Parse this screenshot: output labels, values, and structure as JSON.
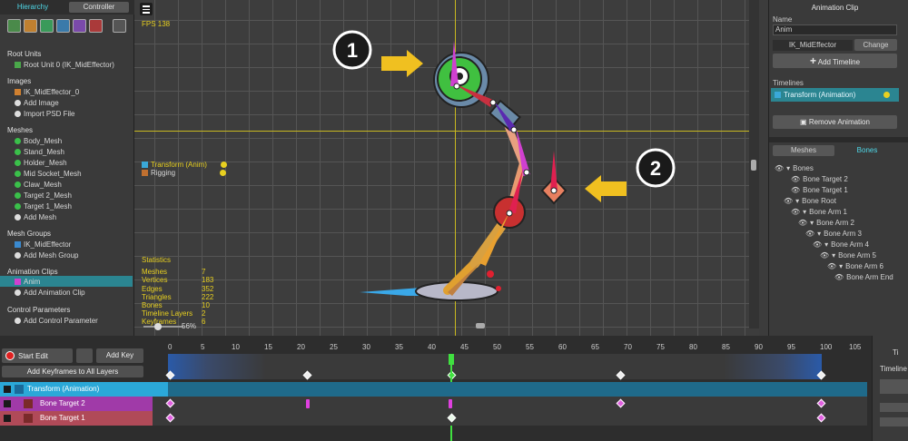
{
  "left_panel": {
    "tabs": [
      "Hierarchy",
      "Controller"
    ],
    "sections": [
      {
        "title": "Root Units",
        "items": [
          "Root Unit 0 (IK_MidEffector)"
        ]
      },
      {
        "title": "Images",
        "items": [
          "IK_MidEffector_0",
          "Add Image",
          "Import PSD File"
        ]
      },
      {
        "title": "Meshes",
        "items": [
          "Body_Mesh",
          "Stand_Mesh",
          "Holder_Mesh",
          "Mid Socket_Mesh",
          "Claw_Mesh",
          "Target 2_Mesh",
          "Target 1_Mesh",
          "Add Mesh"
        ]
      },
      {
        "title": "Mesh Groups",
        "items": [
          "IK_MidEffector",
          "Add Mesh Group"
        ]
      },
      {
        "title": "Animation Clips",
        "items": [
          "Anim",
          "Add Animation Clip"
        ]
      },
      {
        "title": "Control Parameters",
        "items": [
          "Add Control Parameter"
        ]
      }
    ]
  },
  "viewport": {
    "fps": "FPS 138",
    "zoom": "56%",
    "layers": [
      "Transform (Anim)",
      "Rigging"
    ],
    "callouts": [
      "1",
      "2"
    ],
    "statistics": {
      "title": "Statistics",
      "rows": [
        {
          "k": "Meshes",
          "v": "7"
        },
        {
          "k": "Vertices",
          "v": "183"
        },
        {
          "k": "Edges",
          "v": "352"
        },
        {
          "k": "Triangles",
          "v": "222"
        },
        {
          "k": "Bones",
          "v": "10"
        },
        {
          "k": "Timeline Layers",
          "v": "2"
        },
        {
          "k": "Keyframes",
          "v": "6"
        }
      ]
    }
  },
  "right_panel": {
    "header": "Animation Clip",
    "name_label": "Name",
    "name_value": "Anim",
    "target": "IK_MidEffector",
    "change": "Change",
    "add_timeline": "Add Timeline",
    "timelines_label": "Timelines",
    "timeline_item": "Transform (Animation)",
    "remove": "Remove Animation",
    "tabs": [
      "Meshes",
      "Bones"
    ],
    "bones": [
      "Bones",
      "Bone Target 2",
      "Bone Target 1",
      "Bone Root",
      "Bone Arm 1",
      "Bone Arm 2",
      "Bone Arm 3",
      "Bone Arm 4",
      "Bone Arm 5",
      "Bone Arm 6",
      "Bone Arm End"
    ]
  },
  "timeline": {
    "start_edit": "Start Edit",
    "add_key": "Add Key",
    "add_keyframes_all": "Add Keyframes to All Layers",
    "ruler": [
      "0",
      "5",
      "10",
      "15",
      "20",
      "25",
      "30",
      "35",
      "40",
      "45",
      "50",
      "55",
      "60",
      "65",
      "70",
      "75",
      "80",
      "85",
      "90",
      "95",
      "100",
      "105"
    ],
    "layers": [
      "Transform (Animation)",
      "Bone Target 2",
      "Bone Target 1"
    ],
    "right_cut": [
      "Ti",
      "Timeline"
    ]
  },
  "colors": {
    "accent": "#4fd8e8",
    "selected": "#2b8591",
    "track_blue": "#2ba8d8",
    "track_purple": "#a03aa8",
    "track_red": "#b04a58",
    "yellow": "#e8d020"
  }
}
